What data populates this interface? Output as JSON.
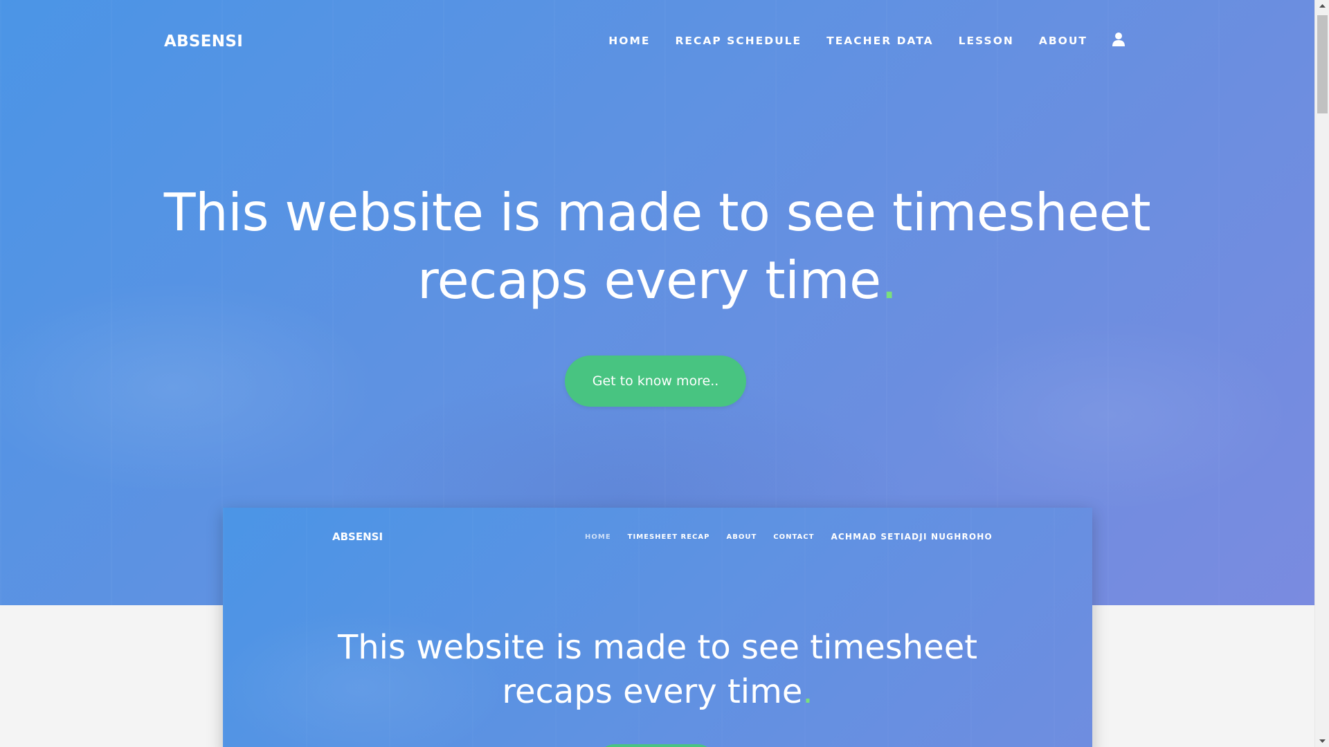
{
  "navbar": {
    "brand": "ABSENSI",
    "links": [
      "HOME",
      "RECAP SCHEDULE",
      "TEACHER DATA",
      "LESSON",
      "ABOUT"
    ],
    "user_icon": "user-icon"
  },
  "hero": {
    "headline_line1": "This website is made to see timesheet",
    "headline_line2": "recaps every time",
    "headline_dot": ".",
    "cta_label": "Get to know more.."
  },
  "preview": {
    "brand": "ABSENSI",
    "links": [
      "HOME",
      "TIMESHEET RECAP",
      "ABOUT",
      "CONTACT"
    ],
    "user_name": "ACHMAD SETIADJI NUGHROHO",
    "headline_line1": "This website is made to see timesheet",
    "headline_line2": "recaps every time",
    "headline_dot": "."
  },
  "colors": {
    "hero_gradient_start": "#4b95e6",
    "hero_gradient_end": "#7a8be0",
    "cta_green": "#48c481",
    "dot_green": "#7be07b"
  }
}
